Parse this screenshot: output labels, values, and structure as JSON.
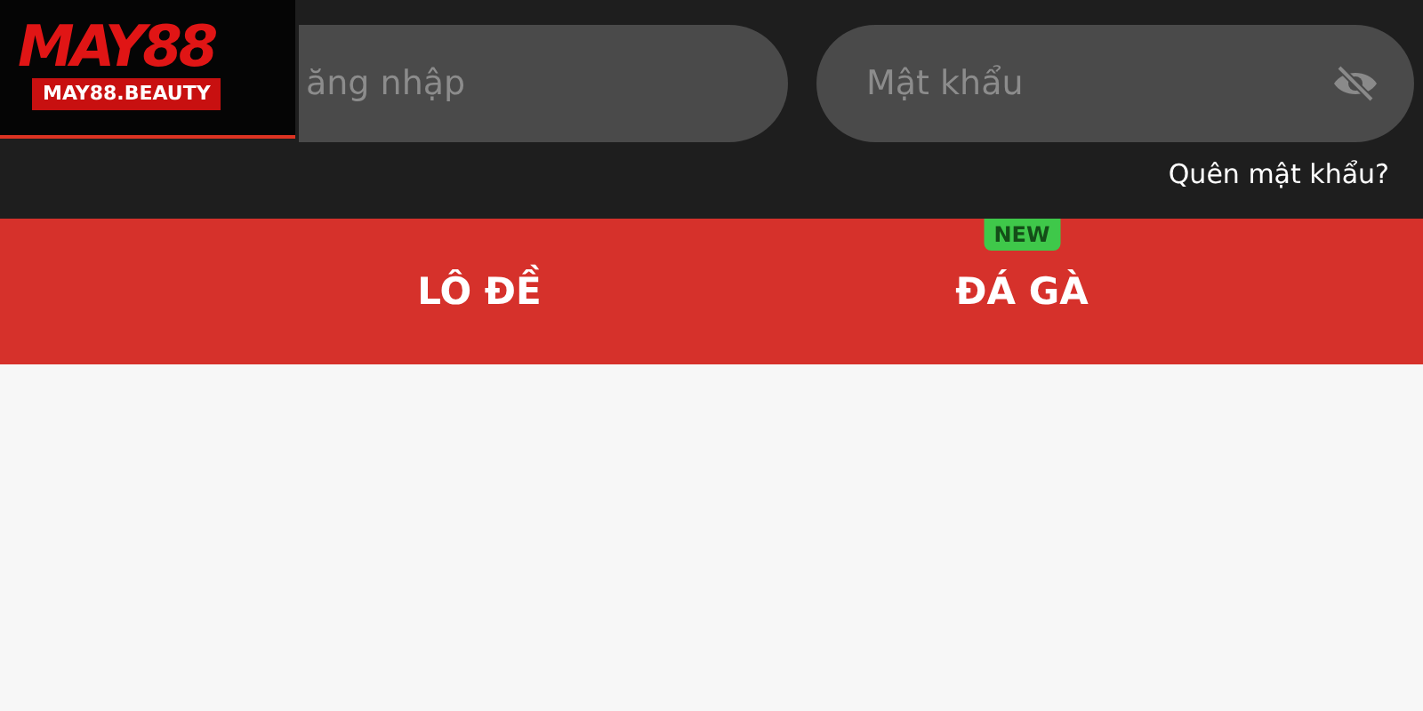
{
  "logo": {
    "title": "MAY88",
    "subtitle": "MAY88.BEAUTY"
  },
  "login": {
    "username": {
      "placeholder": "ăng nhập"
    },
    "password": {
      "placeholder": "Mật khẩu"
    },
    "forgot_link": "Quên mật khẩu?"
  },
  "tabs": [
    {
      "label": "LÔ ĐỀ"
    },
    {
      "label": "ĐÁ GÀ",
      "badge": "NEW"
    }
  ]
}
